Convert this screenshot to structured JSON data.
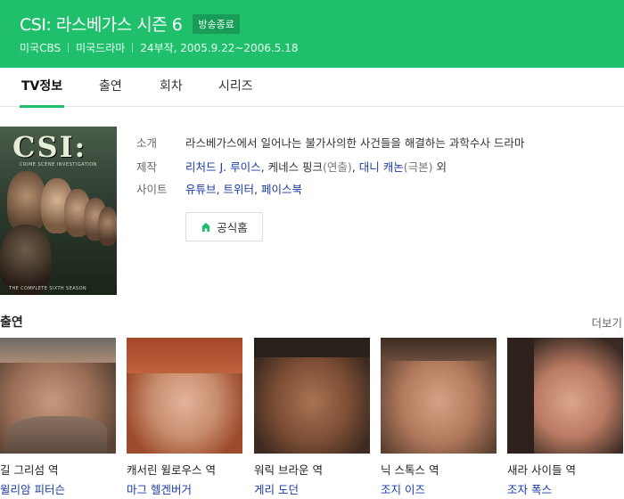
{
  "header": {
    "title": "CSI: 라스베가스 시즌 6",
    "status_badge": "방송종료",
    "meta": [
      "미국CBS",
      "미국드라마",
      "24부작, 2005.9.22~2006.5.18"
    ]
  },
  "tabs": [
    {
      "label": "TV정보",
      "active": true
    },
    {
      "label": "출연",
      "active": false
    },
    {
      "label": "회차",
      "active": false
    },
    {
      "label": "시리즈",
      "active": false
    }
  ],
  "poster": {
    "logo": "CSI:",
    "subtitle": "CRIME SCENE INVESTIGATION",
    "footer": "THE COMPLETE SIXTH SEASON"
  },
  "info": {
    "intro_label": "소개",
    "intro_value": "라스베가스에서 일어나는 불가사의한 사건들을 해결하는 과학수사 드라마",
    "crew_label": "제작",
    "crew": {
      "director1": "리처드 J. 루이스",
      "director2": "케네스 핑크",
      "director_role": "(연출)",
      "writer": "대니 캐논",
      "writer_role": "(극본)",
      "etc": "외"
    },
    "site_label": "사이트",
    "sites": [
      "유튜브",
      "트위터",
      "페이스북"
    ],
    "home_button": "공식홈"
  },
  "cast_section": {
    "title": "출연",
    "more": "더보기",
    "members": [
      {
        "role": "길 그리섬 역",
        "actor": "윌리암 피터슨"
      },
      {
        "role": "캐서린 윌로우스 역",
        "actor": "마그 헬겐버거"
      },
      {
        "role": "워릭 브라운 역",
        "actor": "게리 도던"
      },
      {
        "role": "닉 스톡스 역",
        "actor": "조지 이즈"
      },
      {
        "role": "새라 사이들 역",
        "actor": "조자 폭스"
      }
    ]
  },
  "colors": {
    "brand_green": "#1fbf6b",
    "link_blue": "#1a3aa6"
  }
}
